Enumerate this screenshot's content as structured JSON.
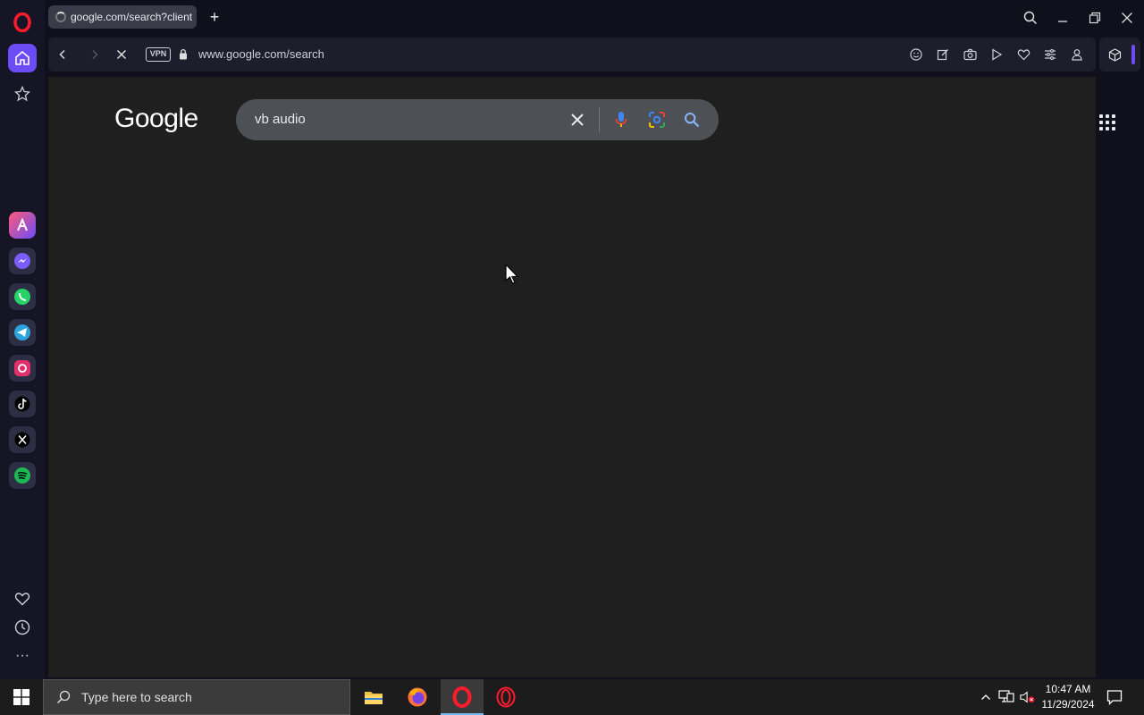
{
  "browser": {
    "tab_title": "google.com/search?client",
    "new_tab_label": "+",
    "vpn_label": "VPN",
    "url": "www.google.com/search",
    "accent_color": "#6b4cf6"
  },
  "sidebar": {
    "apps": [
      "aria-icon",
      "messenger-icon",
      "whatsapp-icon",
      "telegram-icon",
      "instagram-icon",
      "tiktok-icon",
      "x-icon",
      "spotify-icon"
    ],
    "bottom": [
      "heart-icon",
      "history-icon",
      "more-icon"
    ],
    "more_label": "···"
  },
  "page": {
    "logo_text": "Google",
    "search_query": "vb audio"
  },
  "taskbar": {
    "search_placeholder": "Type here to search",
    "time": "10:47 AM",
    "date": "11/29/2024"
  }
}
